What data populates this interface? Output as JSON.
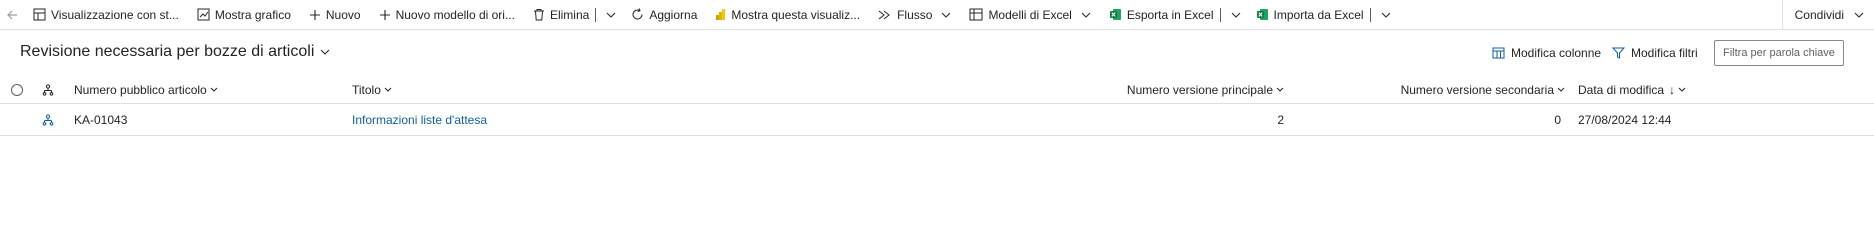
{
  "command_bar": {
    "items": [
      {
        "label": "Visualizzazione con st...",
        "icon": "layout-icon"
      },
      {
        "label": "Mostra grafico",
        "icon": "chart-icon"
      },
      {
        "label": "Nuovo",
        "icon": "plus-icon"
      },
      {
        "label": "Nuovo modello di ori...",
        "icon": "plus-icon"
      },
      {
        "label": "Elimina",
        "icon": "trash-icon"
      },
      {
        "label": "Aggiorna",
        "icon": "refresh-icon"
      },
      {
        "label": "Mostra questa visualiz...",
        "icon": "powerbi-icon"
      },
      {
        "label": "Flusso",
        "icon": "flow-icon"
      },
      {
        "label": "Modelli di Excel",
        "icon": "excel-template-icon"
      },
      {
        "label": "Esporta in Excel",
        "icon": "excel-icon"
      },
      {
        "label": "Importa da Excel",
        "icon": "excel-icon"
      }
    ],
    "share_label": "Condividi"
  },
  "view": {
    "title": "Revisione necessaria per bozze di articoli",
    "edit_columns_label": "Modifica colonne",
    "edit_filters_label": "Modifica filtri",
    "keyword_filter_placeholder": "Filtra per parola chiave",
    "keyword_filter_value": ""
  },
  "grid": {
    "columns": {
      "article_number": "Numero pubblico articolo",
      "title": "Titolo",
      "major_version": "Numero versione principale",
      "minor_version": "Numero versione secondaria",
      "modified_on": "Data di modifica"
    },
    "sort_indicator": "↓",
    "rows": [
      {
        "article_number": "KA-01043",
        "title": "Informazioni liste d'attesa",
        "major_version": "2",
        "minor_version": "0",
        "modified_on": "27/08/2024 12:44"
      }
    ]
  },
  "colors": {
    "link": "#115ea3",
    "excel_green": "#107c41",
    "powerbi_yellow": "#f2c811",
    "border": "#e1dfdd"
  }
}
